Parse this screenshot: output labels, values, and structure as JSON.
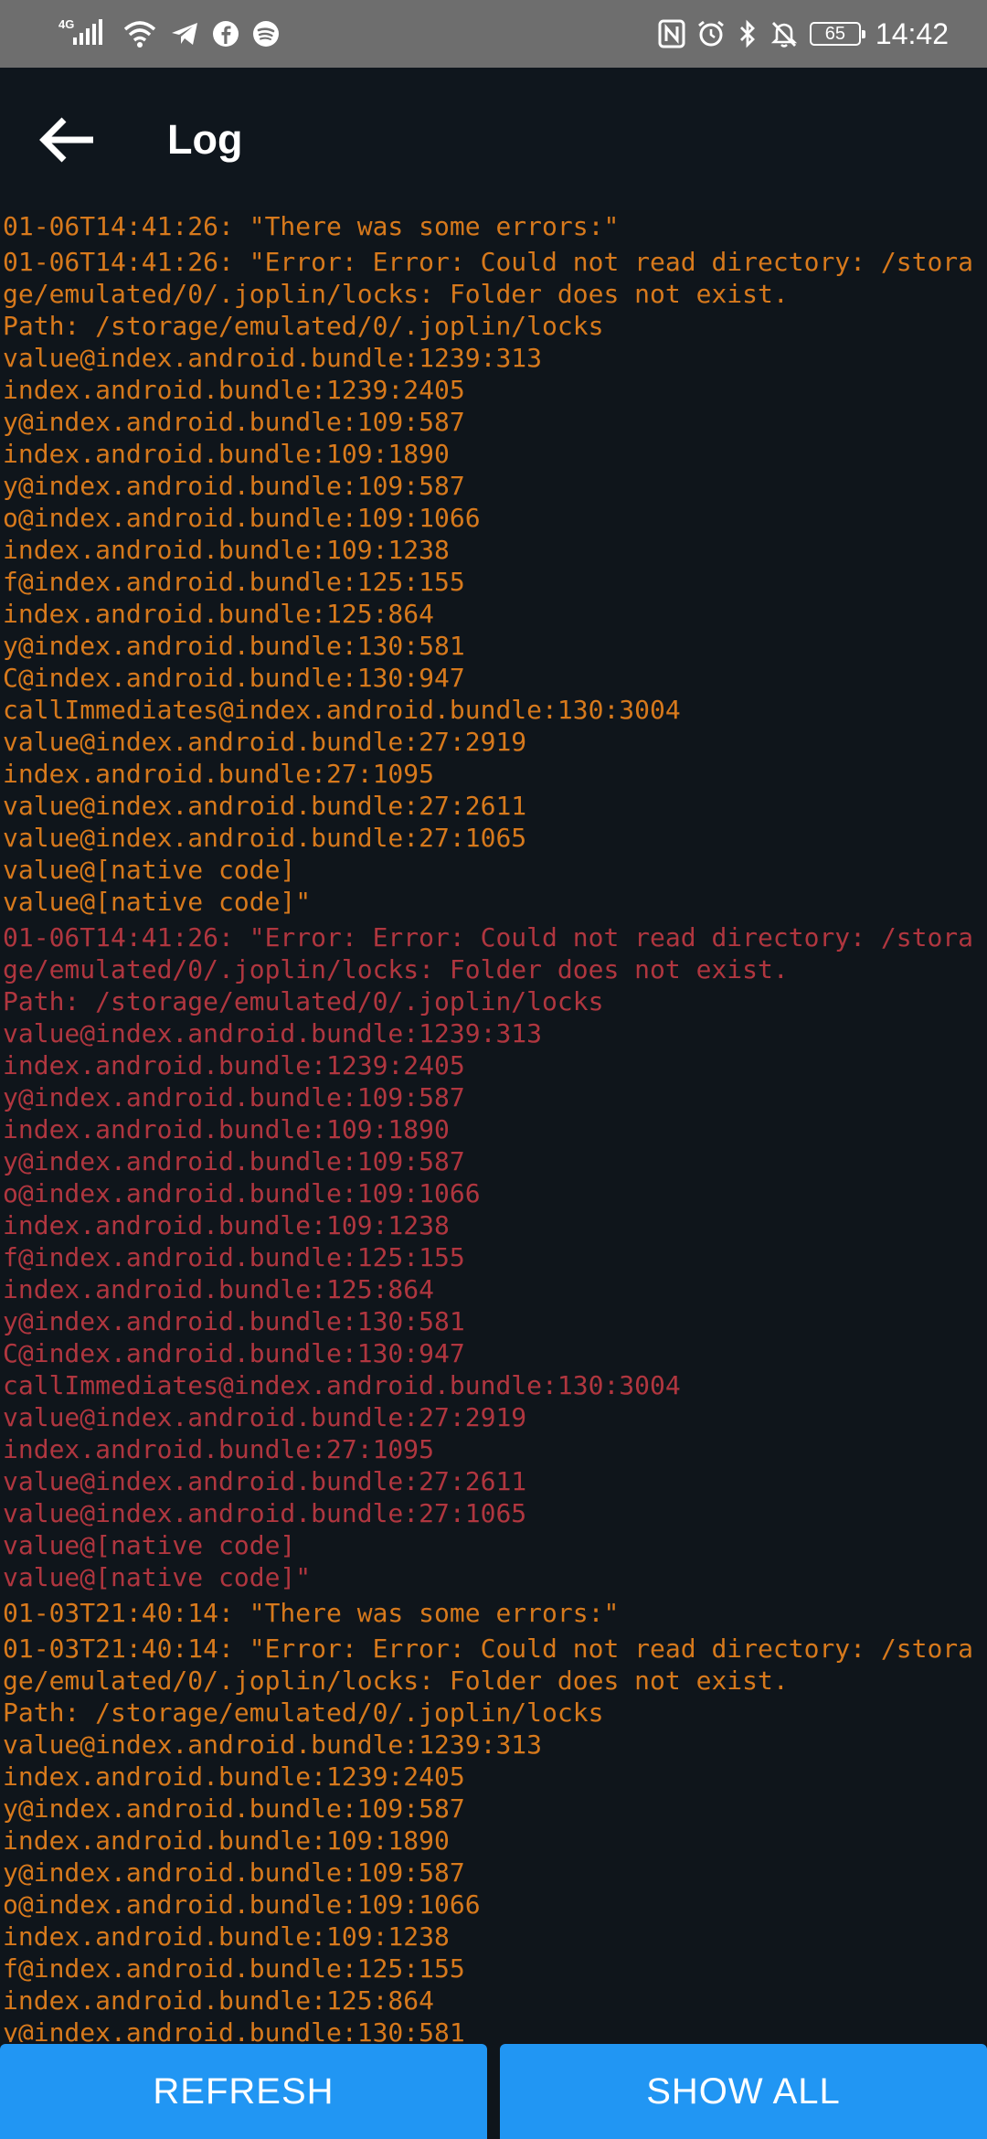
{
  "status_bar": {
    "network": "4G",
    "time": "14:42",
    "battery": "65",
    "icons": [
      "signal-icon",
      "wifi-icon",
      "telegram-icon",
      "facebook-icon",
      "spotify-icon",
      "nfc-icon",
      "alarm-icon",
      "bluetooth-icon",
      "mute-icon",
      "battery-icon"
    ]
  },
  "header": {
    "title": "Log",
    "back_icon": "arrow-left-icon"
  },
  "colors": {
    "info": "#d7791c",
    "error": "#b0363f",
    "accent": "#2196f3",
    "background": "#0f151b"
  },
  "log": {
    "entries": [
      {
        "level": "info",
        "text": "01-06T14:41:26: \"There was some errors:\""
      },
      {
        "level": "info",
        "text": "01-06T14:41:26: \"Error: Error: Could not read directory: /storage/emulated/0/.joplin/locks: Folder does not exist.\nPath: /storage/emulated/0/.joplin/locks\nvalue@index.android.bundle:1239:313\nindex.android.bundle:1239:2405\ny@index.android.bundle:109:587\nindex.android.bundle:109:1890\ny@index.android.bundle:109:587\no@index.android.bundle:109:1066\nindex.android.bundle:109:1238\nf@index.android.bundle:125:155\nindex.android.bundle:125:864\ny@index.android.bundle:130:581\nC@index.android.bundle:130:947\ncallImmediates@index.android.bundle:130:3004\nvalue@index.android.bundle:27:2919\nindex.android.bundle:27:1095\nvalue@index.android.bundle:27:2611\nvalue@index.android.bundle:27:1065\nvalue@[native code]\nvalue@[native code]\""
      },
      {
        "level": "error",
        "text": "01-06T14:41:26: \"Error: Error: Could not read directory: /storage/emulated/0/.joplin/locks: Folder does not exist.\nPath: /storage/emulated/0/.joplin/locks\nvalue@index.android.bundle:1239:313\nindex.android.bundle:1239:2405\ny@index.android.bundle:109:587\nindex.android.bundle:109:1890\ny@index.android.bundle:109:587\no@index.android.bundle:109:1066\nindex.android.bundle:109:1238\nf@index.android.bundle:125:155\nindex.android.bundle:125:864\ny@index.android.bundle:130:581\nC@index.android.bundle:130:947\ncallImmediates@index.android.bundle:130:3004\nvalue@index.android.bundle:27:2919\nindex.android.bundle:27:1095\nvalue@index.android.bundle:27:2611\nvalue@index.android.bundle:27:1065\nvalue@[native code]\nvalue@[native code]\""
      },
      {
        "level": "info",
        "text": "01-03T21:40:14: \"There was some errors:\""
      },
      {
        "level": "info",
        "text": "01-03T21:40:14: \"Error: Error: Could not read directory: /storage/emulated/0/.joplin/locks: Folder does not exist.\nPath: /storage/emulated/0/.joplin/locks\nvalue@index.android.bundle:1239:313\nindex.android.bundle:1239:2405\ny@index.android.bundle:109:587\nindex.android.bundle:109:1890\ny@index.android.bundle:109:587\no@index.android.bundle:109:1066\nindex.android.bundle:109:1238\nf@index.android.bundle:125:155\nindex.android.bundle:125:864\ny@index.android.bundle:130:581"
      }
    ]
  },
  "actions": {
    "refresh_label": "REFRESH",
    "show_all_label": "SHOW ALL"
  }
}
